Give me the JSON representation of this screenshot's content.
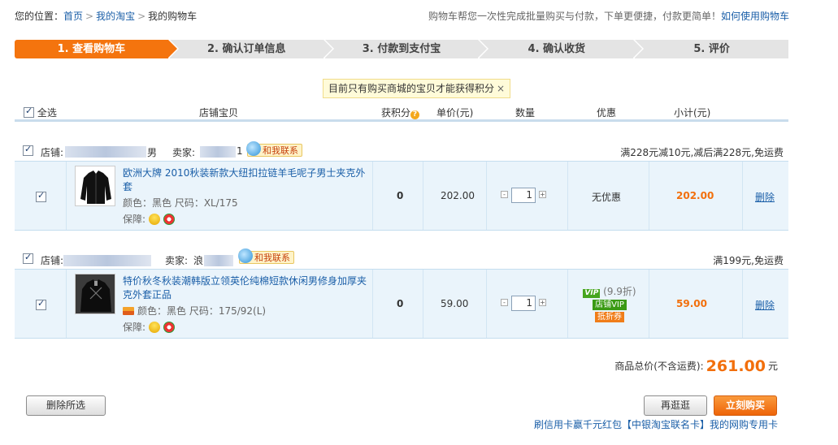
{
  "breadcrumb": {
    "prefix": "您的位置：",
    "home": "首页",
    "my_taobao": "我的淘宝",
    "current": "我的购物车",
    "sep": ">"
  },
  "top_note": {
    "text": "购物车帮您一次性完成批量购买与付款，下单更便捷，付款更简单！",
    "link": "如何使用购物车"
  },
  "steps": [
    {
      "label": "1. 查看购物车",
      "active": true
    },
    {
      "label": "2. 确认订单信息",
      "active": false
    },
    {
      "label": "3. 付款到支付宝",
      "active": false
    },
    {
      "label": "4. 确认收货",
      "active": false
    },
    {
      "label": "5. 评价",
      "active": false
    }
  ],
  "notice": {
    "text": "目前只有购买商城的宝贝才能获得积分",
    "close": "×"
  },
  "table_header": {
    "select_all": "全选",
    "shop_item": "店铺宝贝",
    "points": "获积分",
    "unit_price": "单价(元)",
    "quantity": "数量",
    "discount": "优惠",
    "subtotal": "小计(元)"
  },
  "shops": [
    {
      "shop_label": "店铺:",
      "shop_name_tail": "男",
      "seller_label": "卖家:",
      "seller_name_tail": "1",
      "contact": "和我联系",
      "promo": "满228元减10元,减后满228元,免运费",
      "item": {
        "title": "欧洲大牌 2010秋装新款大纽扣拉链羊毛呢子男士夹克外套",
        "meta": "颜色：黑色   尺码：XL/175",
        "guarantee": "保障:",
        "points": "0",
        "price": "202.00",
        "qty": "1",
        "discount": "无优惠",
        "subtotal": "202.00",
        "delete": "删除"
      }
    },
    {
      "shop_label": "店铺:",
      "shop_name_tail": "",
      "seller_label": "卖家:",
      "seller_name_tail": "浪",
      "contact": "和我联系",
      "promo": "满199元,免运费",
      "item": {
        "title": "特价秋冬秋装潮韩版立领英伦纯棉短款休闲男修身加厚夹克外套正品",
        "meta": "颜色：黑色   尺码：175/92(L)",
        "guarantee": "保障:",
        "points": "0",
        "price": "59.00",
        "qty": "1",
        "vip": "VIP",
        "vip_pct": "(9.9折)",
        "tag_vip": "店铺VIP",
        "tag_coupon": "抵折券",
        "subtotal": "59.00",
        "delete": "删除"
      }
    }
  ],
  "qty_controls": {
    "minus": "-",
    "plus": "+"
  },
  "total": {
    "label": "商品总价(不含运费):",
    "amount": "261.00",
    "unit": "元"
  },
  "buttons": {
    "delete_selected": "删除所选",
    "continue": "再逛逛",
    "buy_now": "立刻购买"
  },
  "bottom_link": "刷信用卡赢千元红包【中银淘宝联名卡】我的网购专用卡",
  "colors": {
    "accent": "#f4740e",
    "link": "#1b5fa8",
    "row_bg": "#eaf4fb",
    "price": "#f26f0c"
  }
}
